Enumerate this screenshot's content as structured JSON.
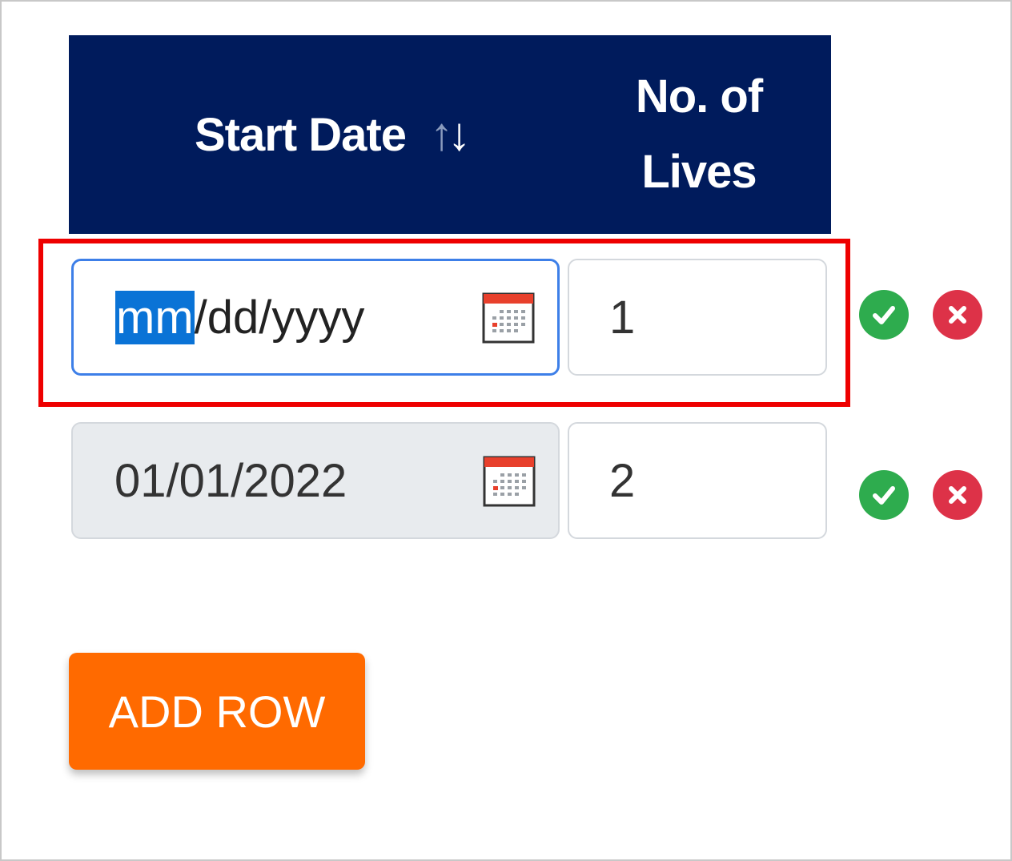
{
  "table": {
    "headers": {
      "start_date": "Start Date",
      "sort_up": "↑",
      "sort_down": "↓",
      "lives_line1": "No. of",
      "lives_line2": "Lives"
    },
    "rows": [
      {
        "date_selected_segment": "mm",
        "date_rest": "/dd/yyyy",
        "lives": "1",
        "state": "editing"
      },
      {
        "date": "01/01/2022",
        "lives": "2",
        "state": "readonly"
      }
    ]
  },
  "buttons": {
    "add_row": "ADD ROW"
  },
  "icons": {
    "calendar": "calendar-icon",
    "confirm": "check-circle-icon",
    "cancel": "x-circle-icon",
    "sort": "sort-arrows-icon"
  },
  "colors": {
    "header_bg": "#001b5c",
    "highlight": "#ee0000",
    "confirm": "#2eac4e",
    "cancel": "#dd3248",
    "add_row": "#ff6a00",
    "focus": "#3d7fe8"
  }
}
